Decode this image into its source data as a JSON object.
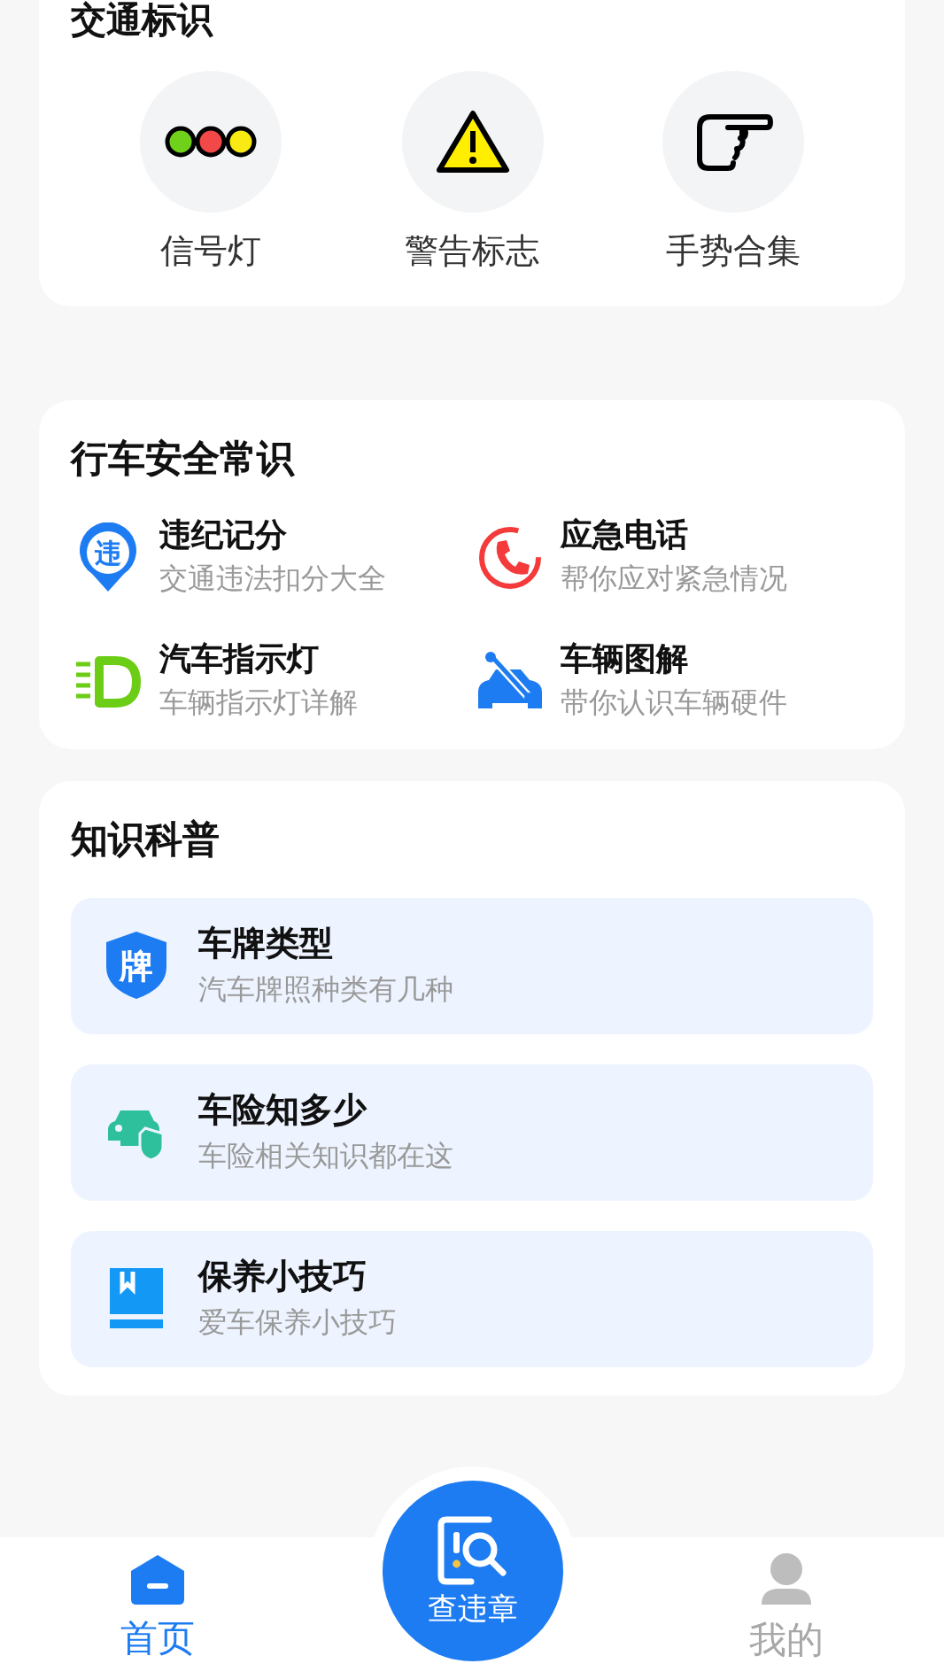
{
  "traffic_signs": {
    "title": "交通标识",
    "items": [
      {
        "label": "信号灯"
      },
      {
        "label": "警告标志"
      },
      {
        "label": "手势合集"
      }
    ]
  },
  "safety": {
    "title": "行车安全常识",
    "items": [
      {
        "title": "违纪记分",
        "subtitle": "交通违法扣分大全",
        "icon_text": "违"
      },
      {
        "title": "应急电话",
        "subtitle": "帮你应对紧急情况"
      },
      {
        "title": "汽车指示灯",
        "subtitle": "车辆指示灯详解"
      },
      {
        "title": "车辆图解",
        "subtitle": "带你认识车辆硬件"
      }
    ]
  },
  "knowledge": {
    "title": "知识科普",
    "items": [
      {
        "title": "车牌类型",
        "subtitle": "汽车牌照种类有几种",
        "icon_text": "牌"
      },
      {
        "title": "车险知多少",
        "subtitle": "车险相关知识都在这"
      },
      {
        "title": "保养小技巧",
        "subtitle": "爱车保养小技巧"
      }
    ]
  },
  "bottom_nav": {
    "tabs": [
      {
        "label": "首页",
        "selected": true
      },
      {
        "label": "我的",
        "selected": false
      }
    ],
    "center_button": {
      "label": "查违章"
    }
  }
}
